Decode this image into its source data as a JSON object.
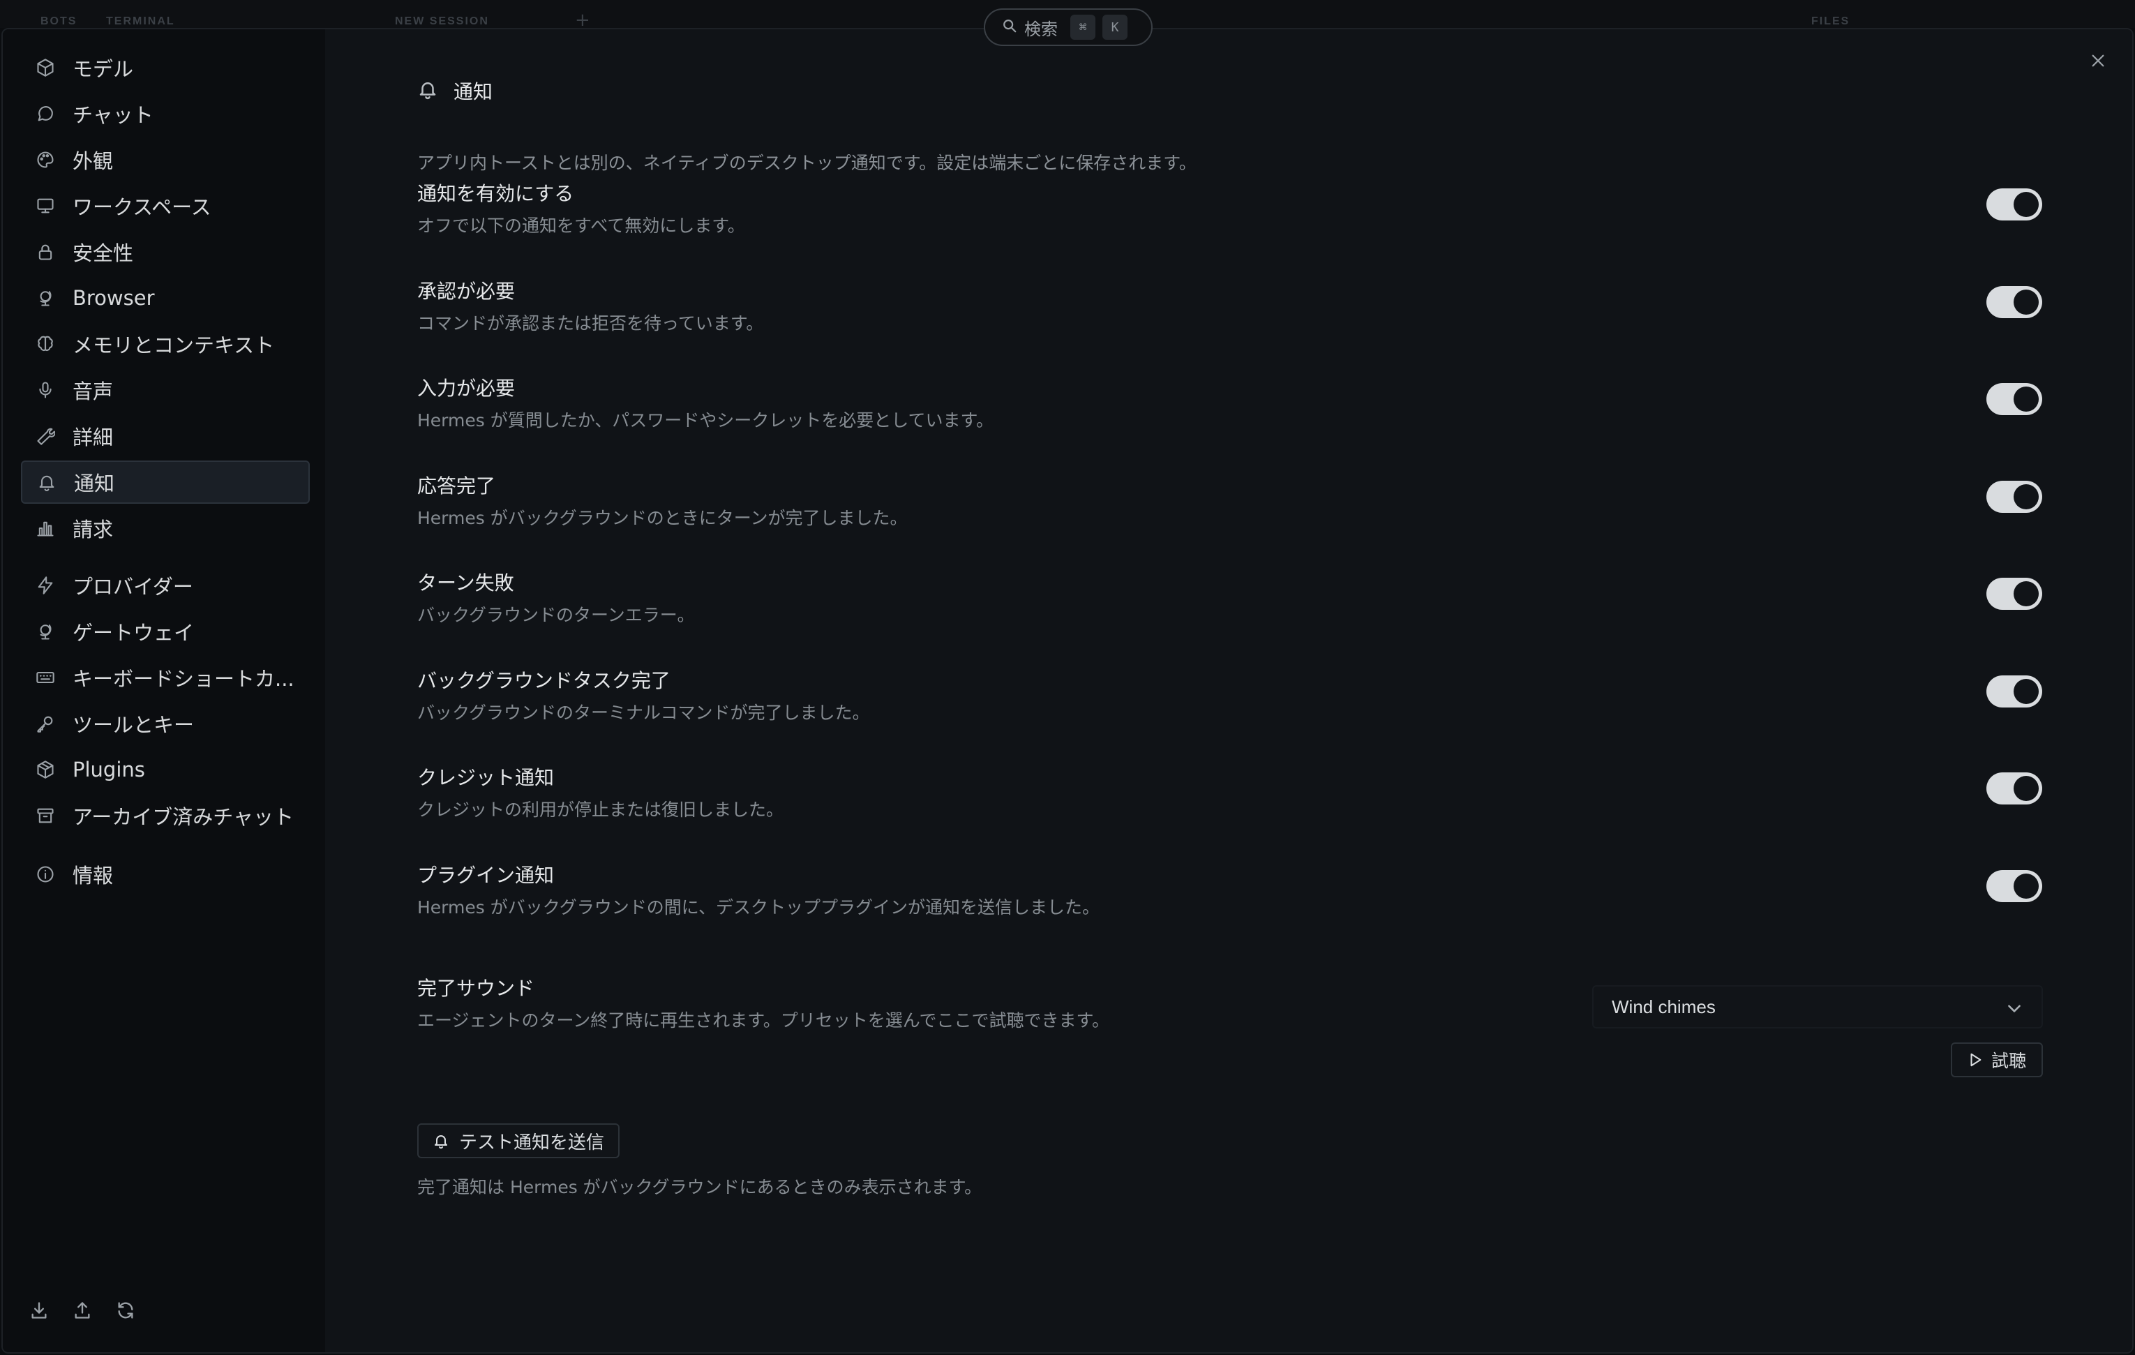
{
  "background": {
    "tabs": [
      {
        "label": "BOTS"
      },
      {
        "label": "TERMINAL"
      },
      {
        "label": "NEW SESSION"
      },
      {
        "label": "FILES"
      }
    ]
  },
  "search": {
    "label": "検索",
    "shortcut_mod": "⌘",
    "shortcut_key": "K"
  },
  "sidebar": {
    "items": [
      {
        "label": "モデル",
        "icon": "cube-icon"
      },
      {
        "label": "チャット",
        "icon": "chat-bubble-icon"
      },
      {
        "label": "外観",
        "icon": "palette-icon"
      },
      {
        "label": "ワークスペース",
        "icon": "monitor-icon"
      },
      {
        "label": "安全性",
        "icon": "lock-icon"
      },
      {
        "label": "Browser",
        "icon": "globe-stand-icon"
      },
      {
        "label": "メモリとコンテキスト",
        "icon": "brain-icon"
      },
      {
        "label": "音声",
        "icon": "microphone-icon"
      },
      {
        "label": "詳細",
        "icon": "wrench-icon"
      },
      {
        "label": "通知",
        "icon": "bell-icon",
        "active": true
      },
      {
        "label": "請求",
        "icon": "bar-chart-icon"
      },
      {
        "label": "プロバイダー",
        "icon": "lightning-icon"
      },
      {
        "label": "ゲートウェイ",
        "icon": "globe-stand-icon"
      },
      {
        "label": "キーボードショートカ...",
        "icon": "keyboard-icon"
      },
      {
        "label": "ツールとキー",
        "icon": "key-icon"
      },
      {
        "label": "Plugins",
        "icon": "package-icon"
      },
      {
        "label": "アーカイブ済みチャット",
        "icon": "archive-icon"
      },
      {
        "label": "情報",
        "icon": "info-icon"
      }
    ],
    "footer_icons": [
      "download-icon",
      "upload-icon",
      "refresh-icon"
    ]
  },
  "content": {
    "section_title": "通知",
    "section_desc": "アプリ内トーストとは別の、ネイティブのデスクトップ通知です。設定は端末ごとに保存されます。",
    "toggles": [
      {
        "title": "通知を有効にする",
        "desc": "オフで以下の通知をすべて無効にします。",
        "on": true
      },
      {
        "title": "承認が必要",
        "desc": "コマンドが承認または拒否を待っています。",
        "on": true
      },
      {
        "title": "入力が必要",
        "desc": "Hermes が質問したか、パスワードやシークレットを必要としています。",
        "on": true
      },
      {
        "title": "応答完了",
        "desc": "Hermes がバックグラウンドのときにターンが完了しました。",
        "on": true
      },
      {
        "title": "ターン失敗",
        "desc": "バックグラウンドのターンエラー。",
        "on": true
      },
      {
        "title": "バックグラウンドタスク完了",
        "desc": "バックグラウンドのターミナルコマンドが完了しました。",
        "on": true
      },
      {
        "title": "クレジット通知",
        "desc": "クレジットの利用が停止または復旧しました。",
        "on": true
      },
      {
        "title": "プラグイン通知",
        "desc": "Hermes がバックグラウンドの間に、デスクトッププラグインが通知を送信しました。",
        "on": true
      }
    ],
    "sound": {
      "title": "完了サウンド",
      "desc": "エージェントのターン終了時に再生されます。プリセットを選んでここで試聴できます。",
      "selected": "Wind chimes",
      "preview_label": "試聴"
    },
    "test_button": "テスト通知を送信",
    "footnote": "完了通知は Hermes がバックグラウンドにあるときのみ表示されます。"
  }
}
